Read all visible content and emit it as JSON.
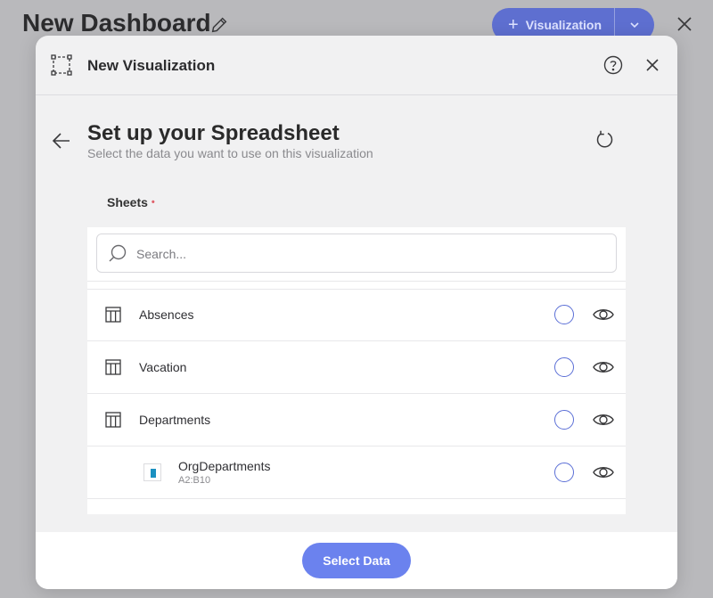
{
  "background": {
    "dashboard_title": "New Dashboard",
    "visualization_button_label": "Visualization"
  },
  "modal": {
    "title": "New Visualization",
    "page_title": "Set up your Spreadsheet",
    "page_subtitle": "Select the data you want to use on this visualization",
    "sheets_label": "Sheets",
    "required_marker": "•",
    "search": {
      "placeholder": "Search...",
      "value": ""
    },
    "items": [
      {
        "label": "Absences",
        "type": "sheet",
        "selected": false
      },
      {
        "label": "Vacation",
        "type": "sheet",
        "selected": false
      },
      {
        "label": "Departments",
        "type": "sheet",
        "selected": false
      },
      {
        "label": "OrgDepartments",
        "range": "A2:B10",
        "type": "named-range",
        "selected": false
      }
    ],
    "footer": {
      "select_button_label": "Select Data"
    }
  },
  "colors": {
    "accent": "#6b82ee",
    "radio_border": "#5b6fd6",
    "range_icon": "#1b90c0",
    "required": "#e0606a"
  },
  "icons": [
    "pencil-icon",
    "plus-icon",
    "chevron-down-icon",
    "close-icon",
    "visualization-icon",
    "help-icon",
    "back-arrow-icon",
    "refresh-icon",
    "search-icon",
    "table-icon",
    "eye-icon",
    "named-range-icon"
  ]
}
